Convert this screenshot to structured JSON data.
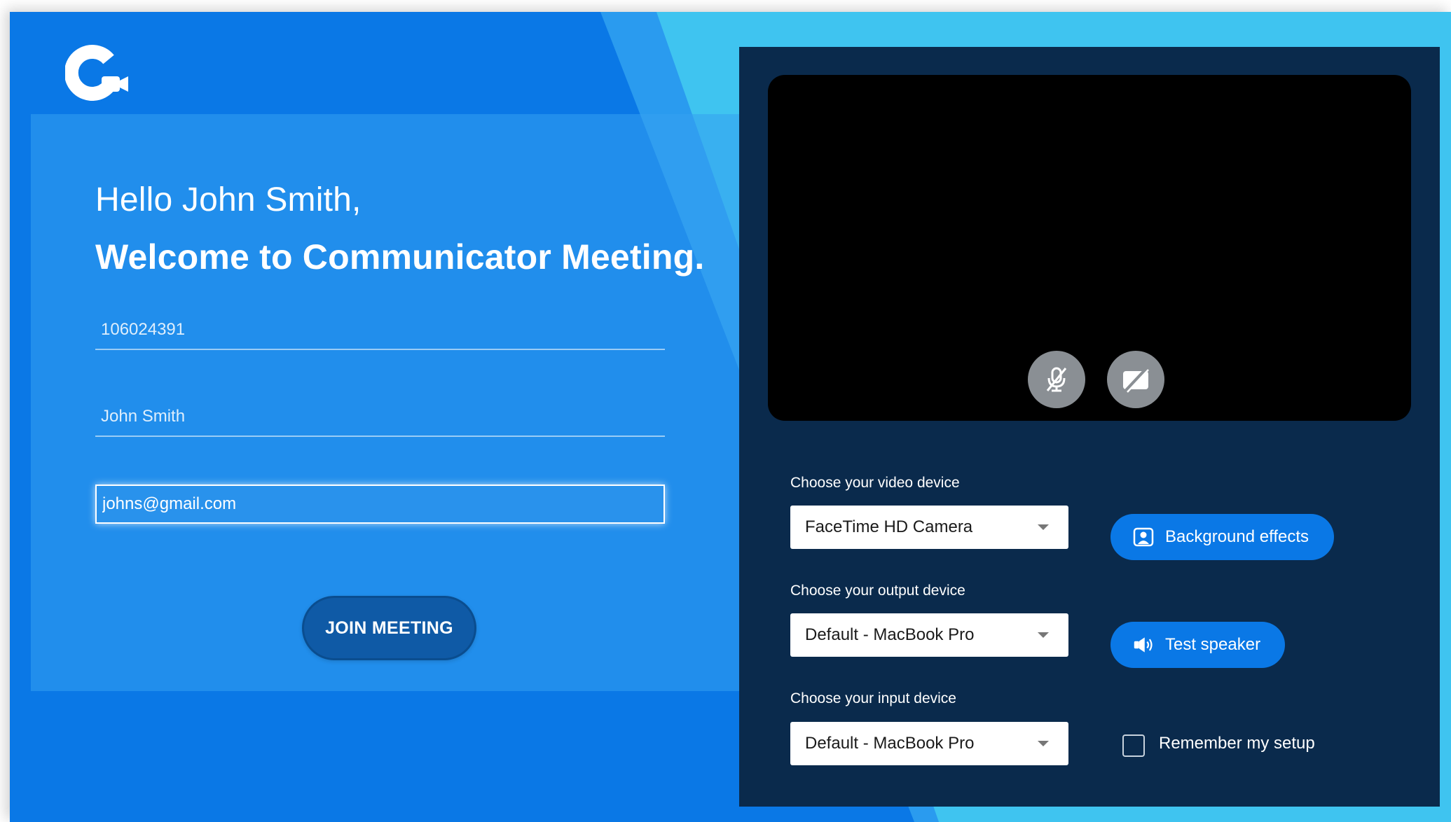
{
  "app": {
    "logo_icon": "communicator-camera-logo-icon"
  },
  "colors": {
    "primary": "#0a78e6",
    "panel": "#0a2a4c",
    "join_button": "#0f5aa6",
    "light_accent": "#3fc4f0"
  },
  "login": {
    "greeting": "Hello John Smith,",
    "welcome": "Welcome to Communicator Meeting.",
    "meeting_id": "106024391",
    "name": "John Smith",
    "email": "johns@gmail.com",
    "join_label": "JOIN MEETING"
  },
  "preview": {
    "mic_icon": "mic-off-icon",
    "camera_icon": "camera-off-icon"
  },
  "devices": {
    "video_label": "Choose your video device",
    "video_value": "FaceTime HD Camera",
    "output_label": "Choose your output device",
    "output_value": "Default - MacBook Pro",
    "input_label": "Choose your input device",
    "input_value": "Default - MacBook Pro",
    "background_effects_label": "Background effects",
    "test_speaker_label": "Test speaker",
    "remember_label": "Remember my setup"
  }
}
